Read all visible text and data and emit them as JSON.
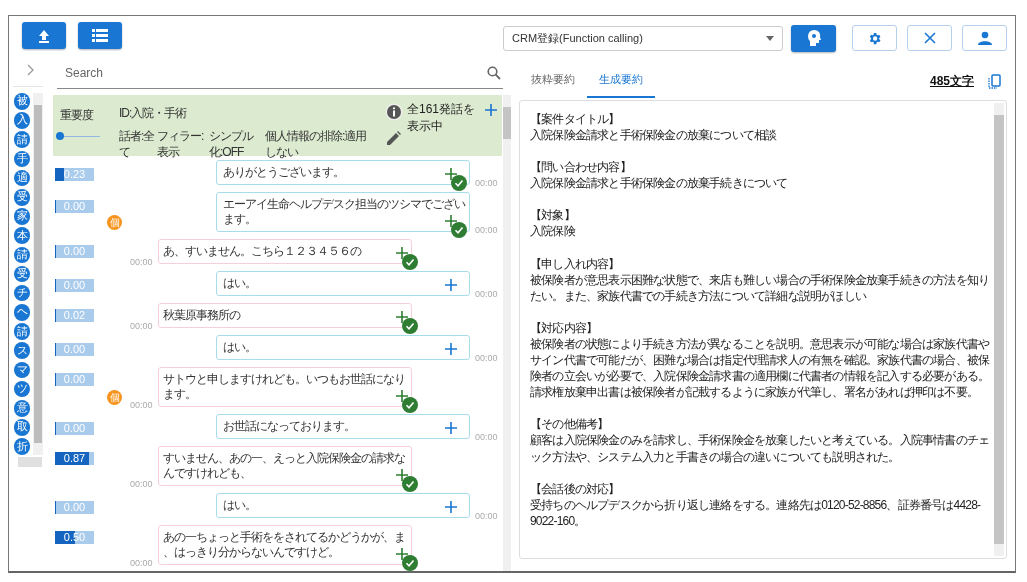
{
  "toolbar": {
    "model_select": "CRM登録(Function calling)"
  },
  "index_letters": [
    "被",
    "入",
    "請",
    "手",
    "適",
    "受",
    "家",
    "本",
    "請",
    "受",
    "チ",
    "ヘ",
    "請",
    "ス",
    "マ",
    "ツ",
    "意",
    "取",
    "折"
  ],
  "search": {
    "placeholder": "Search"
  },
  "filter": {
    "importance_label": "重要度",
    "importance": {
      "level": 0
    },
    "id": "ID:入院・手術",
    "speaker": "話者:全て",
    "filler": "フィラー:表示",
    "simple": "シンプル化:OFF",
    "privacy": "個人情報の排除:適用しない",
    "count": "全161発話を表示中"
  },
  "messages": [
    {
      "kind": "operator",
      "score": "0.23",
      "level": 0.23,
      "text": "ありがとうございます。",
      "time": "00:00",
      "checked": true,
      "personal": false
    },
    {
      "kind": "operator",
      "score": "0.00",
      "level": 0,
      "text": "エーアイ生命ヘルプデスク担当のツシマでございます。",
      "time": "00:00",
      "checked": true,
      "personal": true,
      "badge": "個"
    },
    {
      "kind": "customer",
      "score": "0.00",
      "level": 0,
      "text": "あ、すいません。こちら１２３４５６の",
      "time": "00:00",
      "checked": true,
      "personal": false
    },
    {
      "kind": "operator",
      "score": "0.00",
      "level": 0,
      "text": "はい。",
      "time": "00:00",
      "checked": false,
      "personal": false
    },
    {
      "kind": "customer",
      "score": "0.02",
      "level": 0.02,
      "text": "秋葉原事務所の",
      "time": "00:00",
      "checked": true,
      "personal": false
    },
    {
      "kind": "operator",
      "score": "0.00",
      "level": 0,
      "text": "はい。",
      "time": "00:00",
      "checked": false,
      "personal": false
    },
    {
      "kind": "customer",
      "score": "0.00",
      "level": 0,
      "text": "サトウと申しますけれども。いつもお世話になります。",
      "time": "00:00",
      "checked": true,
      "personal": true,
      "badge": "個"
    },
    {
      "kind": "operator",
      "score": "0.00",
      "level": 0,
      "text": "お世話になっております。",
      "time": "00:00",
      "checked": false,
      "personal": false
    },
    {
      "kind": "customer",
      "score": "0.87",
      "level": 0.87,
      "text": "すいません、あの一、えっと入院保険金の請求なんですけれども、",
      "time": "00:00",
      "checked": true,
      "personal": false
    },
    {
      "kind": "operator",
      "score": "0.00",
      "level": 0,
      "text": "はい。",
      "time": "00:00",
      "checked": false,
      "personal": false
    },
    {
      "kind": "customer",
      "score": "0.50",
      "level": 0.5,
      "text": "あの一ちょっと手術ををされてるかどうかが、ま、はっきり分からないんですけど。",
      "time": "00:00",
      "checked": true,
      "personal": false
    }
  ],
  "summary_tabs": [
    {
      "label": "抜粋要約",
      "selected": false
    },
    {
      "label": "生成要約",
      "selected": true
    }
  ],
  "char_count": "485文字",
  "summary": [
    {
      "heading": "【案件タイトル】",
      "body": "入院保険金請求と手術保険金の放棄について相談"
    },
    {
      "heading": "【問い合わせ内容】",
      "body": "入院保険金請求と手術保険金の放棄手続きについて"
    },
    {
      "heading": "【対象】",
      "body": "入院保険"
    },
    {
      "heading": "【申し入れ内容】",
      "body": "被保険者が意思表示困難な状態で、来店も難しい場合の手術保険金放棄手続きの方法を知りたい。また、家族代書での手続き方法について詳細な説明がほしい"
    },
    {
      "heading": "【対応内容】",
      "body": "被保険者の状態により手続き方法が異なることを説明。意思表示が可能な場合は家族代書やサイン代書で可能だが、困難な場合は指定代理請求人の有無を確認。家族代書の場合、被保険者の立会いが必要で、入院保険金請求書の適用欄に代書者の情報を記入する必要がある。請求権放棄申出書は被保険者が記載するように家族が代筆し、署名があれば押印は不要。"
    },
    {
      "heading": "【その他備考】",
      "body": "顧客は入院保険金のみを請求し、手術保険金を放棄したいと考えている。入院事情書のチェック方法や、システム入力と手書きの場合の違いについても説明された。"
    },
    {
      "heading": "【会話後の対応】",
      "body": "受持ちのヘルプデスクから折り返し連絡をする。連絡先は0120-52-8856、証券番号は4428-9022-160。"
    }
  ]
}
